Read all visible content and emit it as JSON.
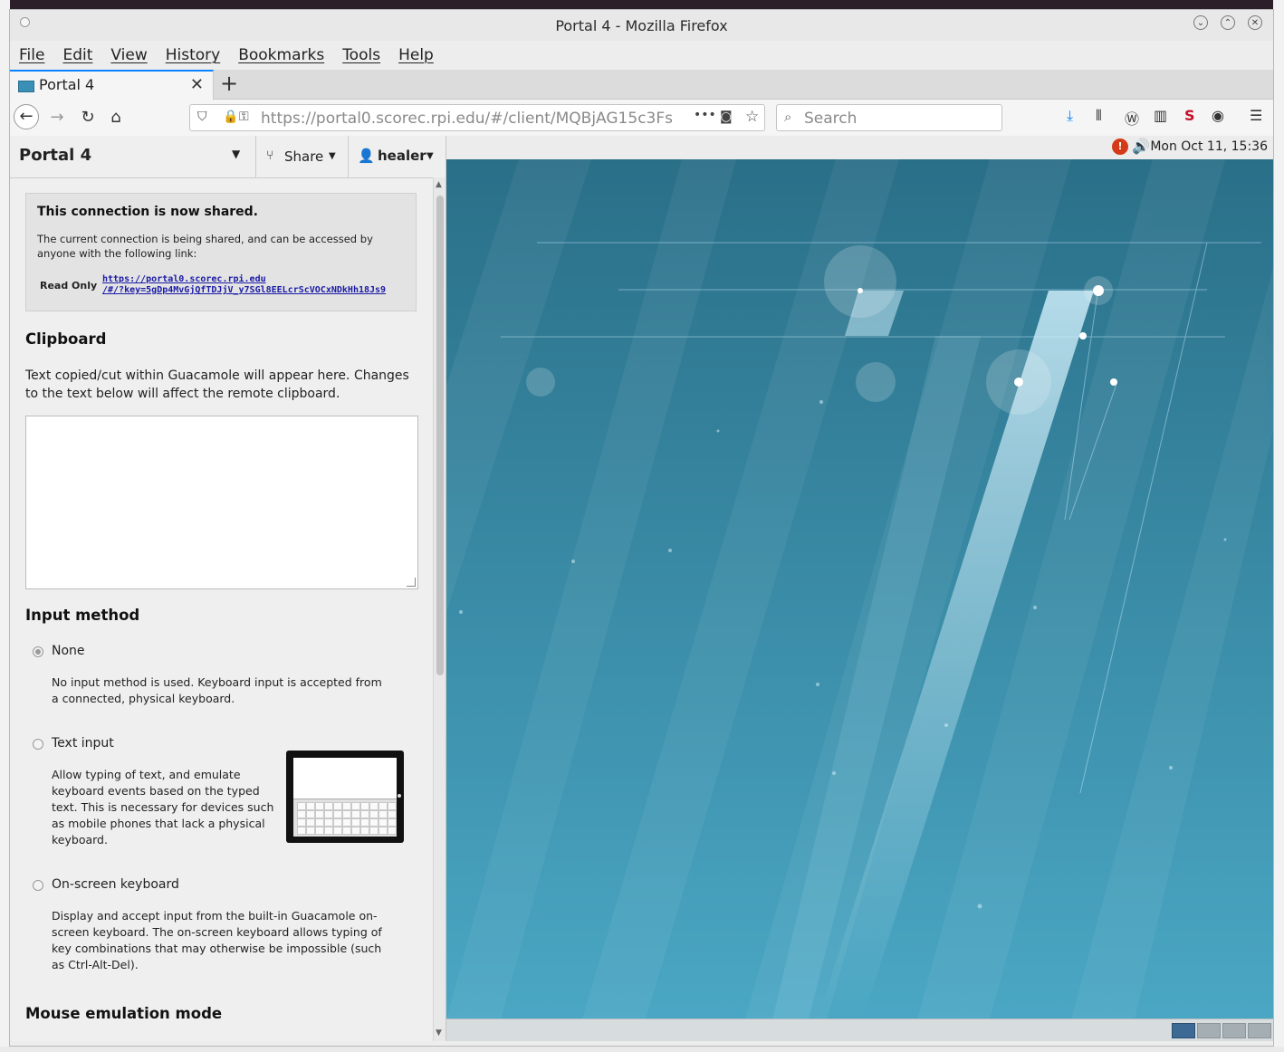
{
  "window": {
    "title": "Portal 4 - Mozilla Firefox",
    "controls": [
      "minimize",
      "maximize",
      "close"
    ]
  },
  "menubar": {
    "items": [
      "File",
      "Edit",
      "View",
      "History",
      "Bookmarks",
      "Tools",
      "Help"
    ]
  },
  "tabs": [
    {
      "label": "Portal 4",
      "active": true
    }
  ],
  "navbar": {
    "url": "https://portal0.scorec.rpi.edu/#/client/MQBjAG15c3Fs",
    "search_placeholder": "Search",
    "overflow_glyph": "•••"
  },
  "guac": {
    "header": {
      "title": "Portal 4",
      "share_label": "Share",
      "user_label": "healer"
    },
    "share_notice": {
      "heading": "This connection is now shared.",
      "body": "The current connection is being shared, and can be accessed by anyone with the following link:",
      "access_label": "Read Only",
      "link_line1": "https://portal0.scorec.rpi.edu",
      "link_line2": "/#/?key=5gDp4MvGjQfTDJjV_y7SGl8EELcrScVOCxNDkHh18Js9"
    },
    "clipboard": {
      "heading": "Clipboard",
      "description": "Text copied/cut within Guacamole will appear here. Changes to the text below will affect the remote clipboard.",
      "value": ""
    },
    "input_method": {
      "heading": "Input method",
      "options": [
        {
          "label": "None",
          "selected": true,
          "description": "No input method is used. Keyboard input is accepted from a connected, physical keyboard."
        },
        {
          "label": "Text input",
          "selected": false,
          "description": "Allow typing of text, and emulate keyboard events based on the typed text. This is necessary for devices such as mobile phones that lack a physical keyboard."
        },
        {
          "label": "On-screen keyboard",
          "selected": false,
          "description": "Display and accept input from the built-in Guacamole on-screen keyboard. The on-screen keyboard allows typing of key combinations that may otherwise be impossible (such as Ctrl-Alt-Del)."
        }
      ]
    },
    "mouse_emulation": {
      "heading": "Mouse emulation mode"
    }
  },
  "remote": {
    "clock": "Mon Oct 11, 15:36",
    "workspaces": [
      {
        "active": true
      },
      {
        "active": false
      },
      {
        "active": false
      },
      {
        "active": false
      }
    ],
    "colors": {
      "wallpaper": "#2f7f99",
      "panel": "#ececec"
    }
  }
}
